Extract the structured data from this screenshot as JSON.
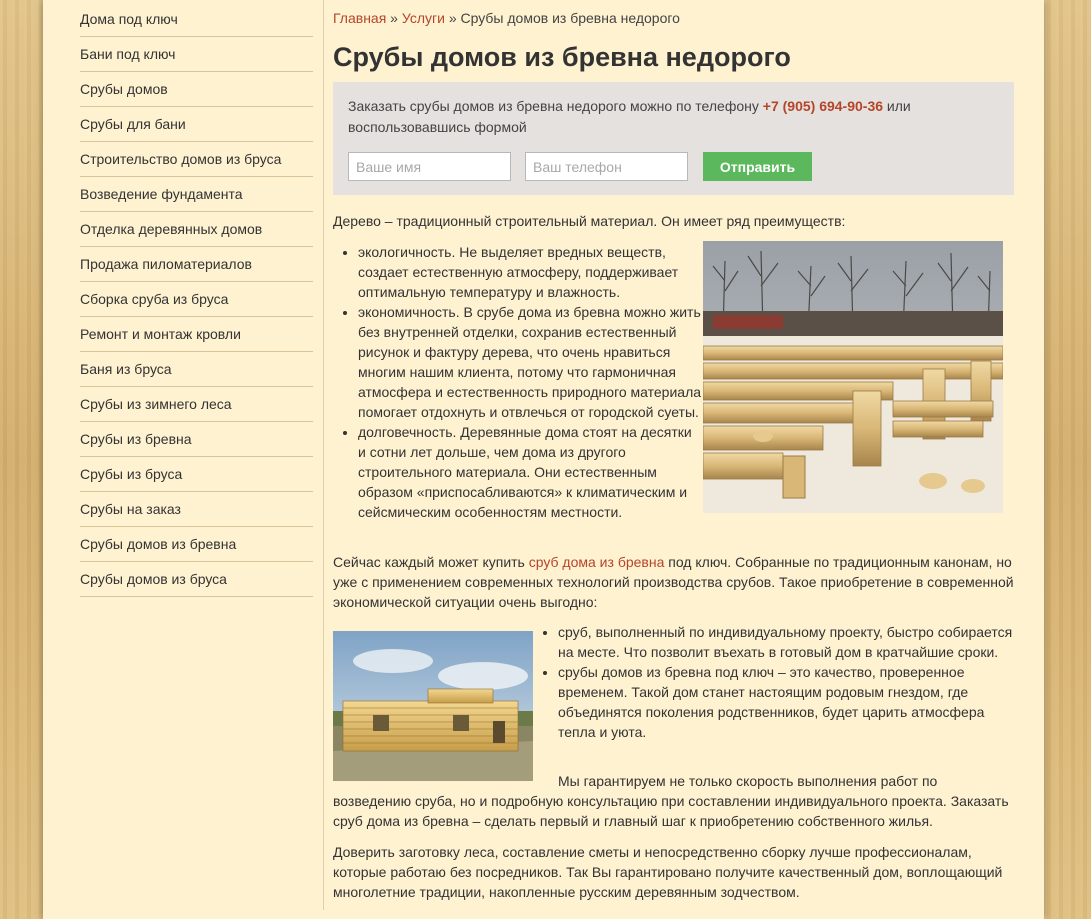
{
  "sidebar": {
    "items": [
      {
        "label": "Дома под ключ"
      },
      {
        "label": "Бани под ключ"
      },
      {
        "label": "Срубы домов"
      },
      {
        "label": "Срубы для бани"
      },
      {
        "label": "Строительство домов из бруса"
      },
      {
        "label": "Возведение фундамента"
      },
      {
        "label": "Отделка деревянных домов"
      },
      {
        "label": "Продажа пиломатериалов"
      },
      {
        "label": "Сборка сруба из бруса"
      },
      {
        "label": "Ремонт и монтаж кровли"
      },
      {
        "label": "Баня из бруса"
      },
      {
        "label": "Срубы из зимнего леса"
      },
      {
        "label": "Срубы из бревна"
      },
      {
        "label": "Срубы из бруса"
      },
      {
        "label": "Срубы на заказ"
      },
      {
        "label": "Срубы домов из бревна"
      },
      {
        "label": "Срубы домов из бруса"
      }
    ]
  },
  "breadcrumb": {
    "home": "Главная",
    "sep1": " » ",
    "services": "Услуги",
    "sep2": " » ",
    "current": "Срубы домов из бревна недорого"
  },
  "page_title": "Срубы домов из бревна недорого",
  "order_form": {
    "text_before": "Заказать срубы домов из бревна недорого можно по телефону ",
    "phone": "+7 (905) 694-90-36",
    "text_after": " или воспользовавшись формой",
    "name_placeholder": "Ваше имя",
    "phone_placeholder": "Ваш телефон",
    "submit_label": "Отправить"
  },
  "article": {
    "intro": "Дерево – традиционный строительный материал. Он имеет ряд преимуществ:",
    "benefits": [
      "экологичность. Не выделяет вредных веществ, создает естественную атмосферу, поддерживает оптимальную температуру и влажность.",
      "экономичность. В срубе дома из бревна можно жить без внутренней отделки, сохранив естественный рисунок и фактуру дерева, что очень нравиться многим нашим клиента, потому что гармоничная атмосфера и естественность природного материала помогает отдохнуть и отвлечься от городской суеты.",
      "долговечность. Деревянные дома стоят на десятки и сотни лет дольше, чем дома из другого строительного материала. Они естественным образом «приспосабливаются» к климатическим и сейсмическим особенностям местности."
    ],
    "para2_before": "Сейчас каждый может купить ",
    "para2_link": "сруб дома из бревна",
    "para2_after": " под ключ. Собранные по традиционным канонам, но уже с применением современных технологий производства срубов. Такое приобретение в современной экономической ситуации очень выгодно:",
    "points": [
      "сруб, выполненный по индивидуальному проекту, быстро собирается на месте. Что позволит въехать в готовый дом в кратчайшие сроки.",
      "срубы домов из бревна под ключ – это качество, проверенное временем. Такой дом станет настоящим родовым гнездом, где объединятся поколения родственников, будет царить атмосфера тепла и уюта."
    ],
    "para3": "Мы гарантируем не только скорость выполнения работ по возведению сруба, но и подробную консультацию при составлении индивидуального проекта. Заказать сруб дома из бревна – сделать первый и главный шаг к приобретению собственного жилья.",
    "para4": "Доверить заготовку леса, составление сметы и непосредственно сборку лучше профессионалам, которые работаю без посредников. Так Вы гарантировано получите качественный дом, воплощающий многолетние традиции, накопленные русским деревянным зодчеством."
  },
  "colors": {
    "page_bg": "#fff2d1",
    "link": "#b5452a",
    "button": "#5cb85c",
    "form_bg": "#e4e1de"
  }
}
